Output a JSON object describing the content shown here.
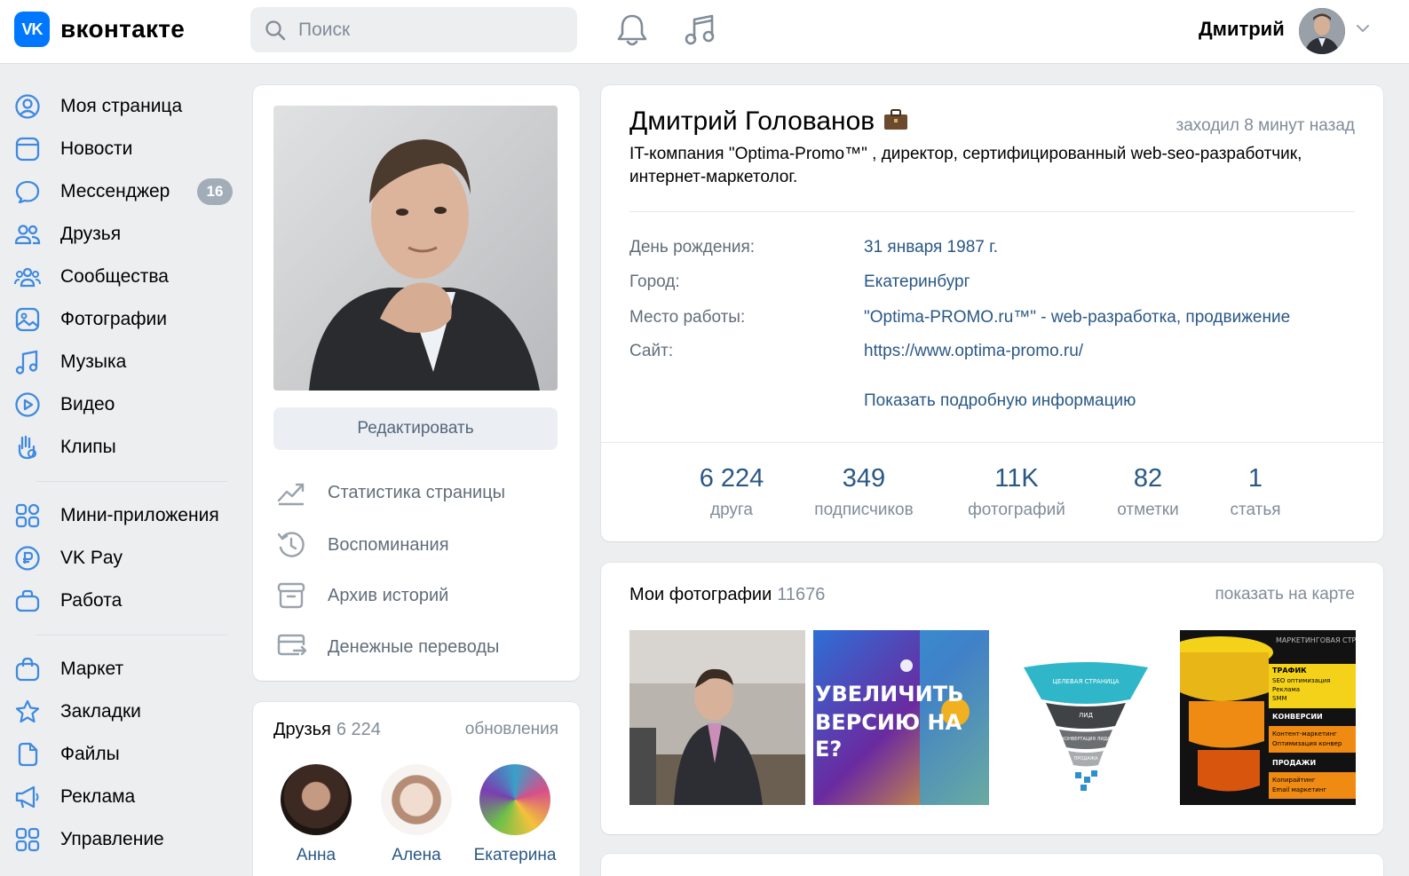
{
  "header": {
    "logo_mark": "VK",
    "logo_text": "вконтакте",
    "search_placeholder": "Поиск",
    "user_name": "Дмитрий"
  },
  "sidebar": {
    "items": [
      {
        "label": "Моя страница",
        "icon": "user-circle-icon"
      },
      {
        "label": "Новости",
        "icon": "news-icon"
      },
      {
        "label": "Мессенджер",
        "icon": "message-icon",
        "badge": "16"
      },
      {
        "label": "Друзья",
        "icon": "friends-icon"
      },
      {
        "label": "Сообщества",
        "icon": "communities-icon"
      },
      {
        "label": "Фотографии",
        "icon": "photo-icon"
      },
      {
        "label": "Музыка",
        "icon": "music-icon"
      },
      {
        "label": "Видео",
        "icon": "video-icon"
      },
      {
        "label": "Клипы",
        "icon": "clips-icon"
      },
      {
        "label": "Мини-приложения",
        "icon": "apps-icon"
      },
      {
        "label": "VK Pay",
        "icon": "vkpay-icon"
      },
      {
        "label": "Работа",
        "icon": "work-icon"
      },
      {
        "label": "Маркет",
        "icon": "market-icon"
      },
      {
        "label": "Закладки",
        "icon": "bookmark-icon"
      },
      {
        "label": "Файлы",
        "icon": "files-icon"
      },
      {
        "label": "Реклама",
        "icon": "ads-icon"
      },
      {
        "label": "Управление",
        "icon": "manage-icon"
      }
    ]
  },
  "profile_left": {
    "edit_label": "Редактировать",
    "menu": [
      {
        "label": "Статистика страницы",
        "icon": "stats-icon"
      },
      {
        "label": "Воспоминания",
        "icon": "memories-icon"
      },
      {
        "label": "Архив историй",
        "icon": "archive-icon"
      },
      {
        "label": "Денежные переводы",
        "icon": "transfer-icon"
      }
    ]
  },
  "friends": {
    "title": "Друзья",
    "count": "6 224",
    "link": "обновления",
    "items": [
      {
        "name": "Анна"
      },
      {
        "name": "Алена"
      },
      {
        "name": "Екатерина"
      }
    ]
  },
  "profile": {
    "name": "Дмитрий Голованов",
    "name_emoji": "💼",
    "last_seen": "заходил 8 минут назад",
    "status": "IT-компания \"Optima-Promo™\" , директор, сертифицированный web-seo-разработчик, интернет-маркетолог.",
    "info": [
      {
        "key": "День рождения:",
        "value": "31 января 1987 г."
      },
      {
        "key": "Город:",
        "value": "Екатеринбург"
      },
      {
        "key": "Место работы:",
        "value": "\"Optima-PROMO.ru™\" - web-разработка, продвижение"
      },
      {
        "key": "Сайт:",
        "value": "https://www.optima-promo.ru/"
      }
    ],
    "more_link": "Показать подробную информацию",
    "counters": [
      {
        "num": "6 224",
        "label": "друга"
      },
      {
        "num": "349",
        "label": "подписчиков"
      },
      {
        "num": "11K",
        "label": "фотографий"
      },
      {
        "num": "82",
        "label": "отметки"
      },
      {
        "num": "1",
        "label": "статья"
      }
    ]
  },
  "photos": {
    "title": "Мои фотографии",
    "count": "11676",
    "link": "показать на карте",
    "thumb2_text": "УВЕЛИЧИТЬ\nВЕРСИЮ НА\nE?",
    "thumb3_labels": [
      "ЦЕЛЕВАЯ СТРАНИЦА",
      "ЛИД",
      "КОНВЕРТАЦИЯ ЛИДА",
      "ПРОДАЖА"
    ],
    "thumb4_labels": [
      "МАРКЕТИНГОВАЯ СТРАТ",
      "ТРАФИК",
      "SEO оптимизация",
      "Реклама",
      "SMM",
      "КОНВЕРСИИ",
      "Контент-маркетинг",
      "Оптимизация конвер",
      "ПРОДАЖИ",
      "Копирайтинг",
      "Email маркетинг"
    ]
  },
  "colors": {
    "accent": "#0077ff",
    "link": "#2a5885",
    "muted": "#818c99",
    "bg": "#edeef0"
  }
}
